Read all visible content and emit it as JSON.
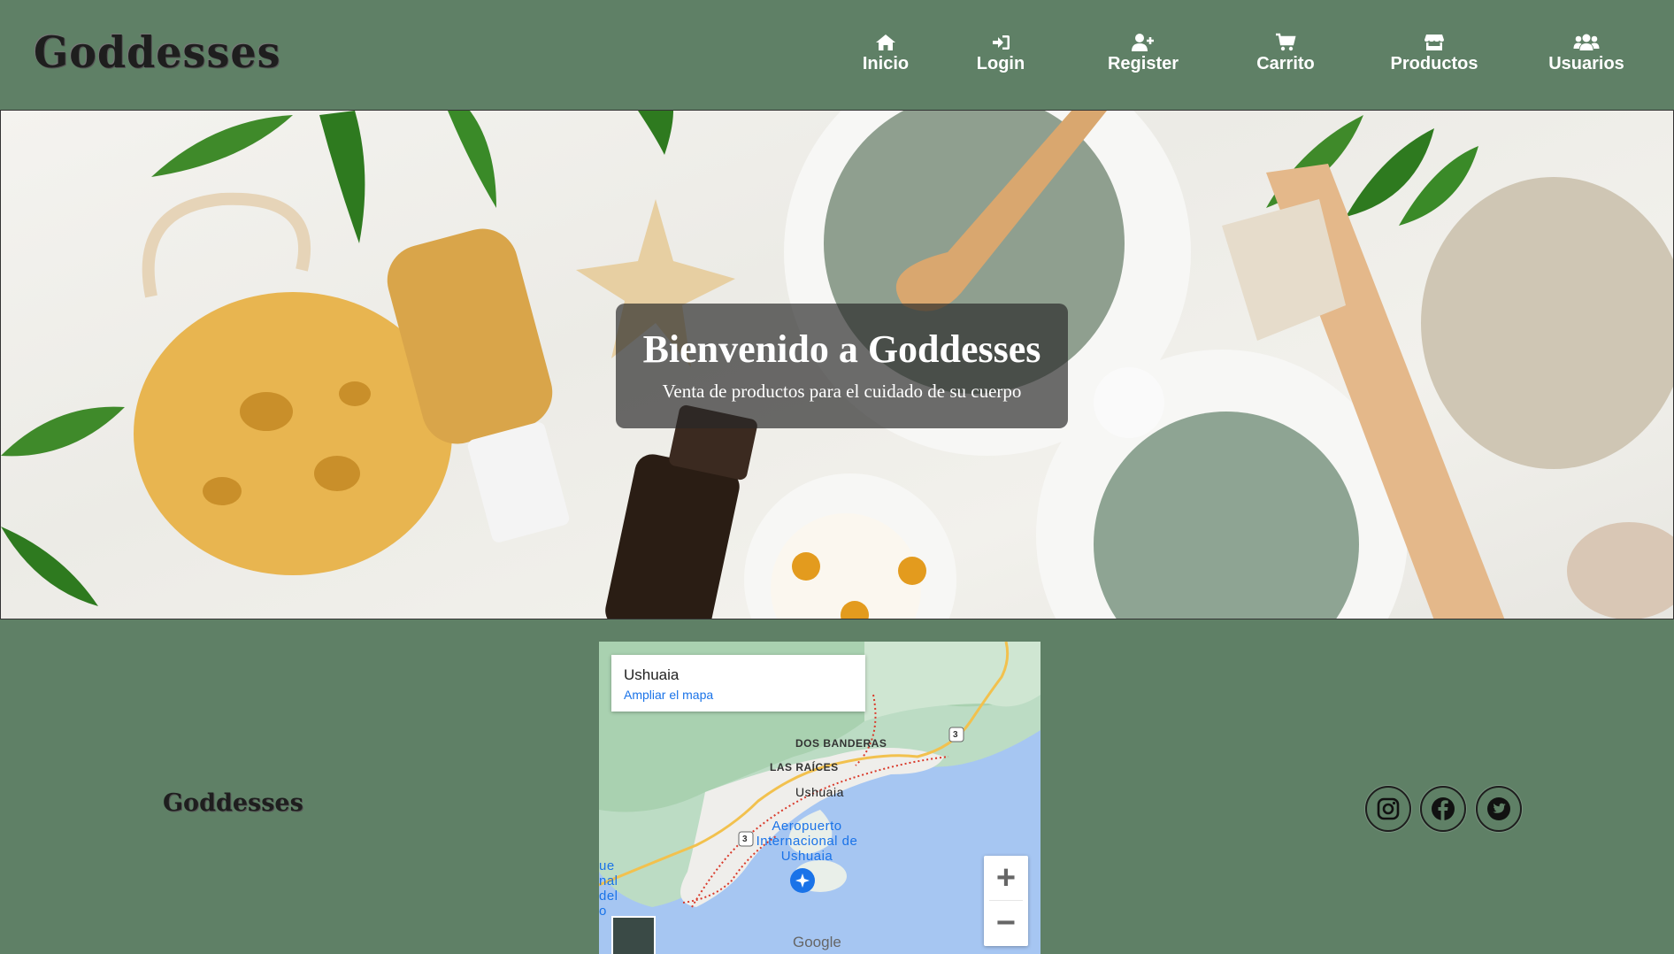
{
  "brand": {
    "name": "Goddesses"
  },
  "nav": {
    "items": [
      {
        "label": "Inicio",
        "icon": "home-icon"
      },
      {
        "label": "Login",
        "icon": "login-icon"
      },
      {
        "label": "Register",
        "icon": "user-plus-icon"
      },
      {
        "label": "Carrito",
        "icon": "cart-icon"
      },
      {
        "label": "Productos",
        "icon": "store-icon"
      },
      {
        "label": "Usuarios",
        "icon": "users-icon"
      }
    ]
  },
  "hero": {
    "title": "Bienvenido a Goddesses",
    "subtitle": "Venta de productos para el cuidado de su cuerpo"
  },
  "footer": {
    "logo": "Goddesses",
    "map": {
      "place": "Ushuaia",
      "link": "Ampliar el mapa",
      "labels": {
        "dos_banderas": "DOS BANDERAS",
        "las_raices": "LAS RAÍCES",
        "ushuaia": "Ushuaia",
        "airport": "Aeropuerto Internacional de Ushuaia",
        "route": "3",
        "edge": "ue nal del o",
        "google": "Google"
      }
    },
    "social": [
      "instagram-icon",
      "facebook-icon",
      "twitter-icon"
    ]
  },
  "colors": {
    "background": "#5f8066",
    "nav_text": "#ffffff",
    "hero_overlay": "rgba(40,40,40,0.68)",
    "map_link": "#1a73e8"
  }
}
